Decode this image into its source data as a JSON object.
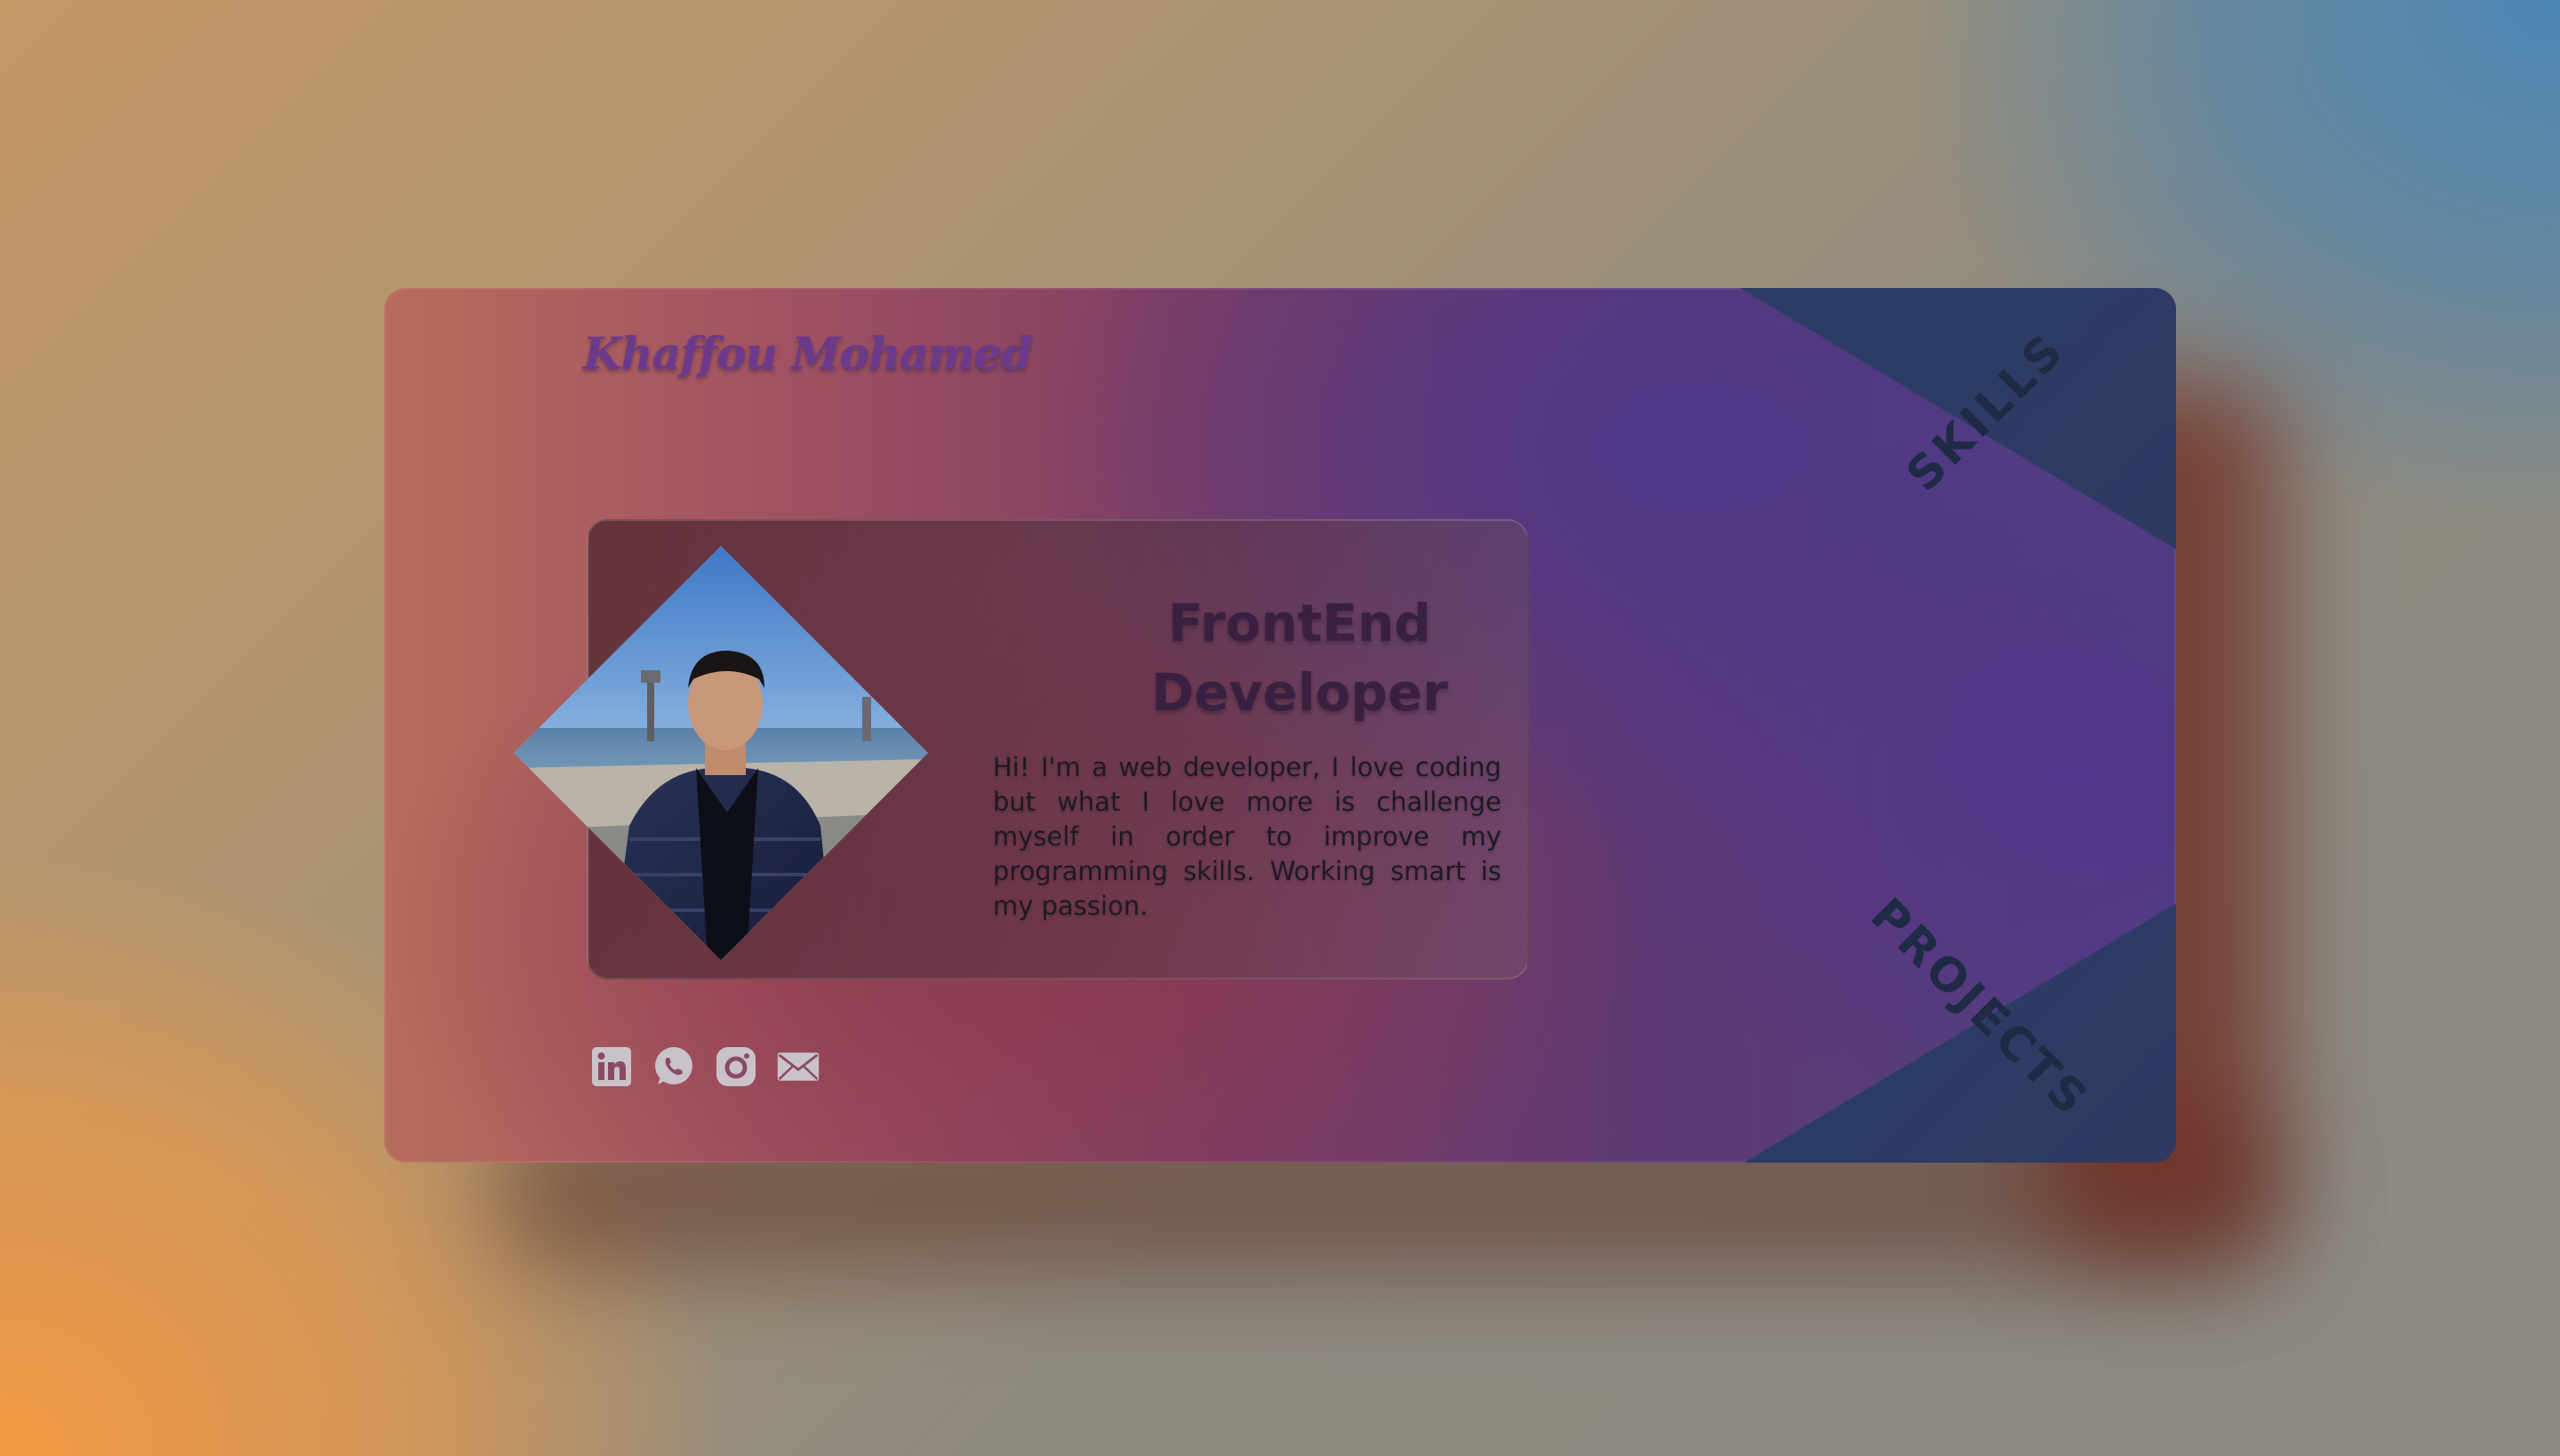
{
  "brand": {
    "name": "Khaffou Mohamed"
  },
  "nav": {
    "skills_label": "SKILLS",
    "projects_label": "PROJECTS"
  },
  "profile": {
    "title_line1": "FrontEnd",
    "title_line2": "Developer",
    "bio": "Hi! I'm a web developer, I love coding but what I love more is challenge myself in order to improve my programming skills. Working smart is my passion.",
    "photo_icon": "portrait-photo"
  },
  "socials": [
    {
      "name": "linkedin",
      "icon": "linkedin-icon"
    },
    {
      "name": "whatsapp",
      "icon": "whatsapp-icon"
    },
    {
      "name": "instagram",
      "icon": "instagram-icon"
    },
    {
      "name": "email",
      "icon": "mail-icon"
    }
  ],
  "colors": {
    "brand_text": "#6b3a8c",
    "corner_fill": "#2b3d66",
    "title_text": "#3a2040",
    "icon_fill": "#c9c3c9"
  }
}
